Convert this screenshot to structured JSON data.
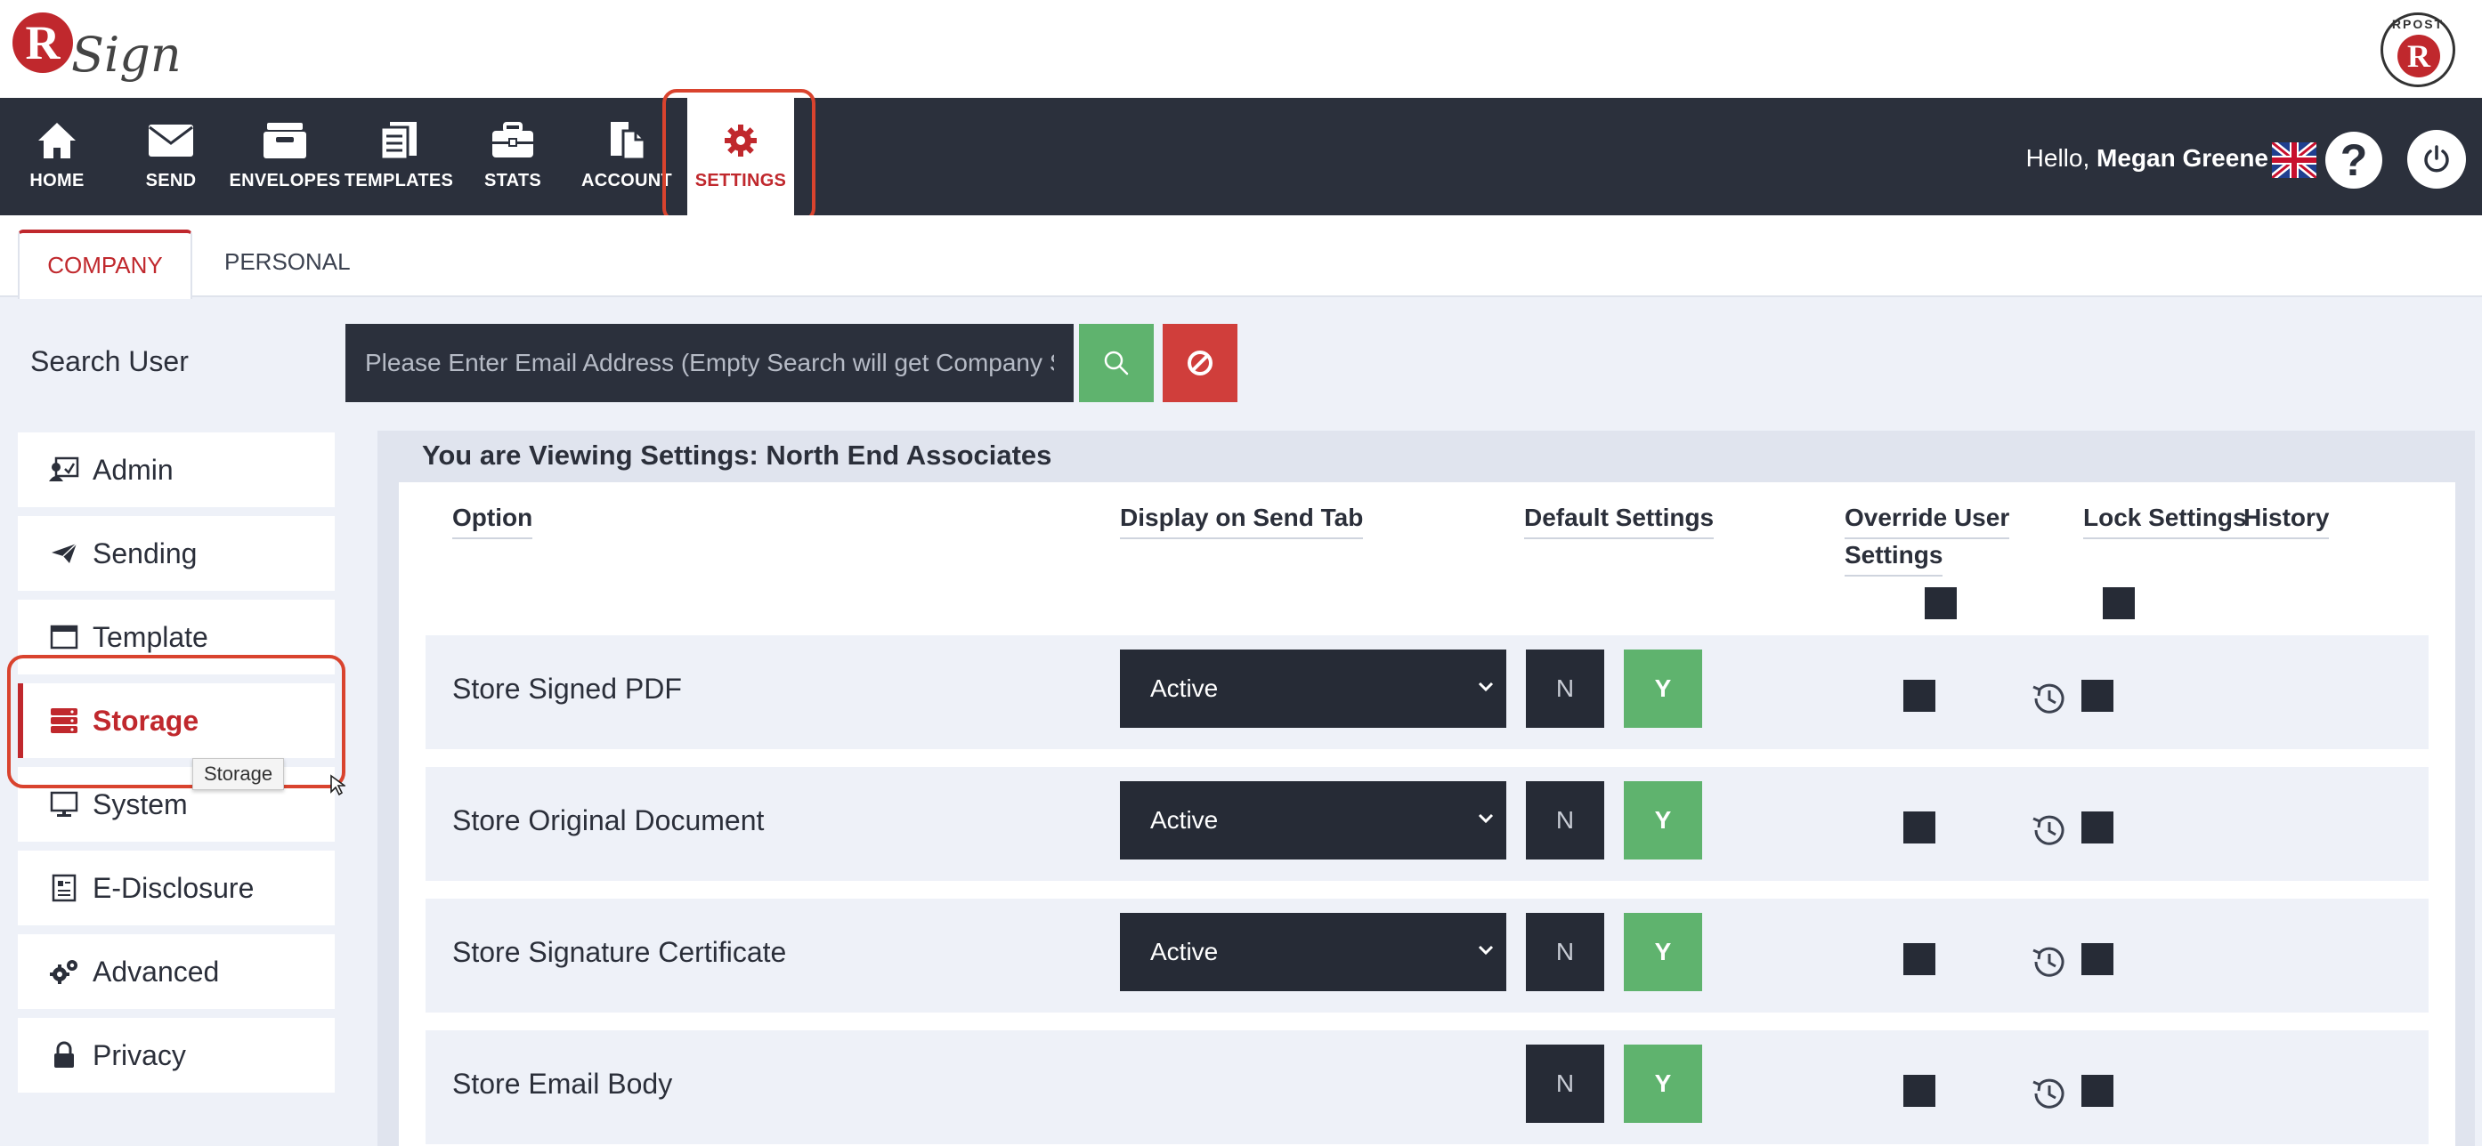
{
  "brand": {
    "logo_letter": "R",
    "logo_text": "Sign",
    "partner_letter": "R",
    "partner_text": "RPOST"
  },
  "nav": {
    "items": [
      {
        "label": "HOME",
        "icon": "home-icon"
      },
      {
        "label": "SEND",
        "icon": "envelope-icon"
      },
      {
        "label": "ENVELOPES",
        "icon": "envelopes-icon"
      },
      {
        "label": "TEMPLATES",
        "icon": "templates-icon"
      },
      {
        "label": "STATS",
        "icon": "briefcase-icon"
      },
      {
        "label": "ACCOUNT",
        "icon": "account-icon"
      },
      {
        "label": "SETTINGS",
        "icon": "gear-icon"
      }
    ],
    "active": "SETTINGS",
    "greeting_prefix": "Hello,",
    "user_name": "Megan Greene",
    "help_label": "?"
  },
  "tabs": [
    {
      "label": "COMPANY",
      "active": true
    },
    {
      "label": "PERSONAL",
      "active": false
    }
  ],
  "search": {
    "label": "Search User",
    "placeholder": "Please Enter Email Address (Empty Search will get Company Settings)"
  },
  "sidebar": {
    "items": [
      {
        "label": "Admin",
        "icon": "admin-icon"
      },
      {
        "label": "Sending",
        "icon": "paper-plane-icon"
      },
      {
        "label": "Template",
        "icon": "window-icon"
      },
      {
        "label": "Storage",
        "icon": "storage-icon"
      },
      {
        "label": "System",
        "icon": "monitor-icon"
      },
      {
        "label": "E-Disclosure",
        "icon": "document-icon"
      },
      {
        "label": "Advanced",
        "icon": "gears-icon"
      },
      {
        "label": "Privacy",
        "icon": "lock-icon"
      }
    ],
    "active": "Storage",
    "tooltip": "Storage"
  },
  "panel": {
    "title": "You are Viewing Settings: North End Associates",
    "columns": {
      "option": "Option",
      "display": "Display on Send Tab",
      "defaults": "Default Settings",
      "override_line1": "Override User",
      "override_line2": "Settings",
      "lock": "Lock Settings",
      "history": "History"
    },
    "rows": [
      {
        "option": "Store Signed PDF",
        "display": "Active",
        "no": "N",
        "yes": "Y"
      },
      {
        "option": "Store Original Document",
        "display": "Active",
        "no": "N",
        "yes": "Y"
      },
      {
        "option": "Store Signature Certificate",
        "display": "Active",
        "no": "N",
        "yes": "Y"
      },
      {
        "option": "Store Email Body",
        "display": "",
        "no": "N",
        "yes": "Y"
      }
    ]
  },
  "colors": {
    "brand_red": "#c0282d",
    "nav_dark": "#2b303c",
    "success_green": "#5fb36e",
    "danger_red": "#d03e3b"
  }
}
